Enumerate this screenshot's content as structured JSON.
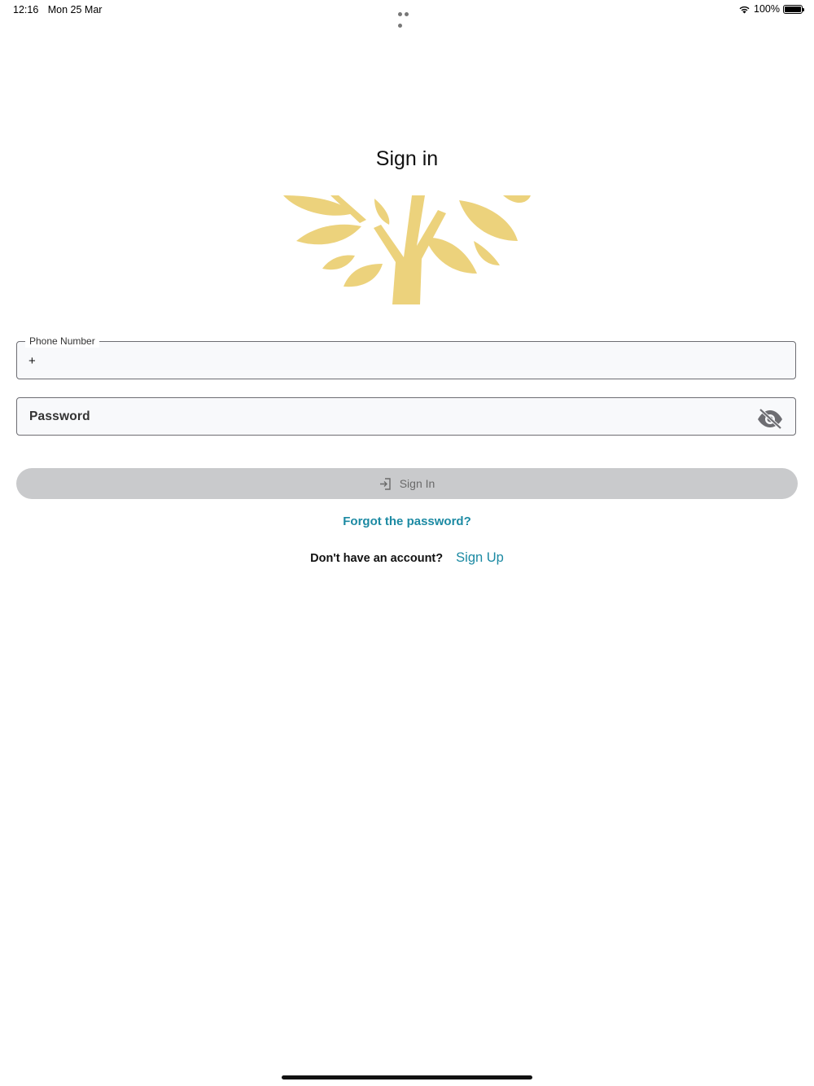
{
  "status_bar": {
    "time": "12:16",
    "date": "Mon 25 Mar",
    "battery": "100%"
  },
  "title": "Sign in",
  "logo": {
    "icon": "tree-logo-icon",
    "color": "#ecd27c"
  },
  "phone": {
    "label": "Phone Number",
    "value": "+"
  },
  "password": {
    "placeholder": "Password",
    "icon": "eye-off-icon"
  },
  "signin_button": {
    "label": "Sign In",
    "icon": "login-icon"
  },
  "forgot_link": "Forgot the password?",
  "signup": {
    "text": "Don't have an account?",
    "link": "Sign Up"
  },
  "colors": {
    "accent": "#1c8aa3",
    "button_disabled": "#c9cacc",
    "logo": "#ecd27c"
  }
}
